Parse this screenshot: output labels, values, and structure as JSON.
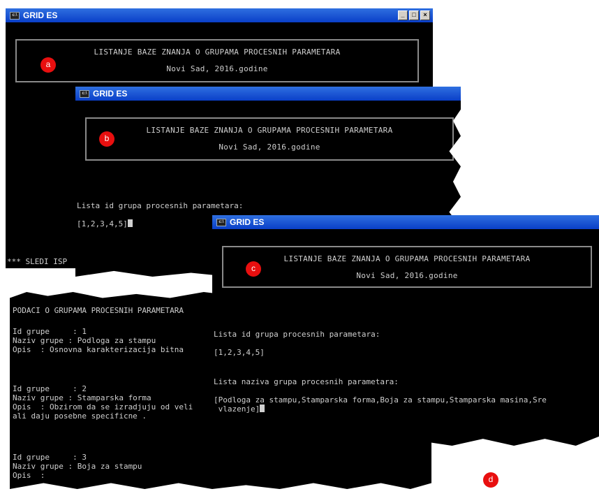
{
  "header": {
    "line1": "LISTANJE BAZE ZNANJA O GRUPAMA PROCESNIH PARAMETARA",
    "line2": "Novi Sad, 2016.godine"
  },
  "windows": {
    "a": {
      "title": "GRID ES",
      "label": "a",
      "footer": "*** SLEDI ISP"
    },
    "b": {
      "title": "GRID ES",
      "label": "b",
      "list_label": "Lista id grupa procesnih parametara:",
      "list_value": "[1,2,3,4,5]"
    },
    "c": {
      "title": "GRID ES",
      "label": "c",
      "list_label": "Lista id grupa procesnih parametara:",
      "list_value": "[1,2,3,4,5]",
      "names_label": "Lista naziva grupa procesnih parametara:",
      "names_line1": "[Podloga za stampu,Stamparska forma,Boja za stampu,Stamparska masina,Sre",
      "names_line2": " vlazenje]"
    },
    "d": {
      "label": "d",
      "heading": "PODACI O GRUPAMA PROCESNIH PARAMETARA",
      "records": [
        {
          "id": "Id grupe     : 1",
          "name": "Naziv grupe : Podloga za stampu",
          "desc": "Opis  : Osnovna karakterizacija bitna",
          "desc2": ""
        },
        {
          "id": "Id grupe     : 2",
          "name": "Naziv grupe : Stamparska forma",
          "desc": "Opis  : Obzirom da se izradjuju od veli",
          "desc2": "ali daju posebne specificne ."
        },
        {
          "id": "Id grupe     : 3",
          "name": "Naziv grupe : Boja za stampu",
          "desc": "Opis  :",
          "desc2": ""
        }
      ]
    }
  },
  "window_controls": {
    "minimize": "_",
    "maximize": "□",
    "close": "×"
  },
  "colors": {
    "title_bar": "#0a3fc8",
    "terminal_bg": "#000000",
    "terminal_text": "#cfcfcf",
    "marker": "#e80f0f"
  }
}
